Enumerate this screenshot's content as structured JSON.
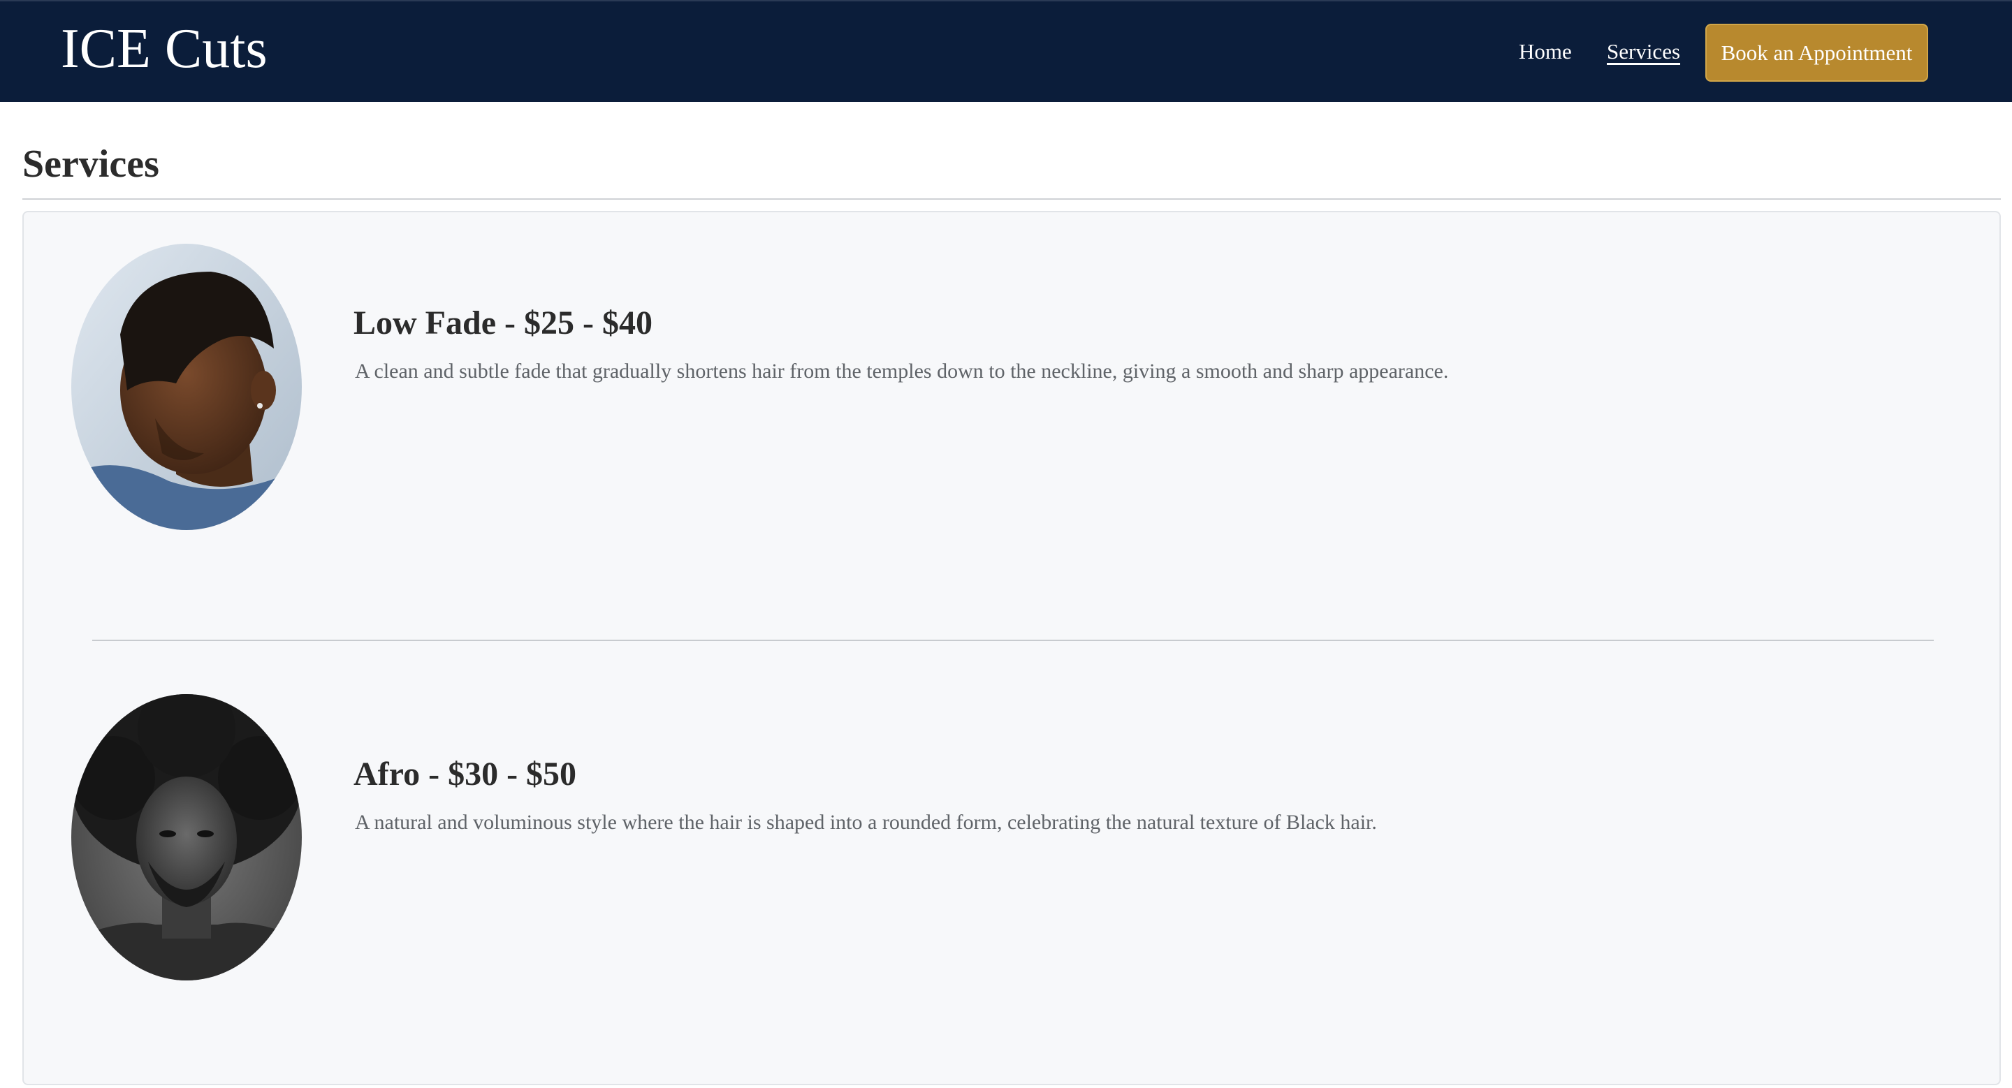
{
  "navbar": {
    "brand": "ICE Cuts",
    "links": [
      {
        "label": "Home",
        "active": false
      },
      {
        "label": "Services",
        "active": true
      }
    ],
    "cta_label": "Book an Appointment",
    "colors": {
      "background": "#0b1d3a",
      "cta": "#b8892e"
    }
  },
  "page": {
    "title": "Services"
  },
  "services": [
    {
      "title": "Low Fade - $25 - $40",
      "description": "A clean and subtle fade that gradually shortens hair from the temples down to the neckline, giving a smooth and sharp appearance.",
      "photo": "low-fade-photo"
    },
    {
      "title": "Afro - $30 - $50",
      "description": "A natural and voluminous style where the hair is shaped into a rounded form, celebrating the natural texture of Black hair.",
      "photo": "afro-photo"
    }
  ]
}
